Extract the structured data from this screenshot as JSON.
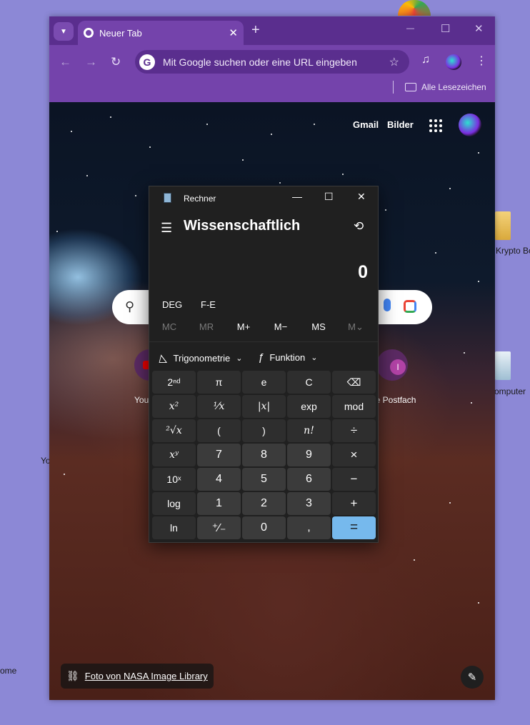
{
  "desktop": {
    "icons": [
      {
        "label": "Krypto Bo"
      },
      {
        "label": "omputer"
      },
      {
        "label": "Yo"
      },
      {
        "label": "ome"
      }
    ]
  },
  "browser": {
    "tab": {
      "title": "Neuer Tab",
      "close": "✕"
    },
    "new_tab": "+",
    "window_controls": {
      "minimize": "—",
      "maximize": "☐",
      "close": "✕"
    },
    "nav": {
      "back": "←",
      "forward": "→",
      "reload": "↻"
    },
    "omnibox": {
      "placeholder": "Mit Google suchen oder eine URL eingeben",
      "badge": "G"
    },
    "bookmarks": {
      "all_label": "Alle Lesezeichen"
    },
    "ntp": {
      "top_links": [
        "Gmail",
        "Bilder"
      ],
      "shortcuts": [
        {
          "label": "You"
        },
        {
          "label": "ne Postfach",
          "letter": "I"
        }
      ],
      "credit": "Foto von NASA Image Library",
      "edit": "✎"
    }
  },
  "calculator": {
    "title": "Rechner",
    "mode": "Wissenschaftlich",
    "display": "0",
    "options": [
      "DEG",
      "F-E"
    ],
    "memory": [
      {
        "label": "MC",
        "enabled": false
      },
      {
        "label": "MR",
        "enabled": false
      },
      {
        "label": "M+",
        "enabled": true
      },
      {
        "label": "M−",
        "enabled": true
      },
      {
        "label": "MS",
        "enabled": true
      },
      {
        "label": "M⌄",
        "enabled": false
      }
    ],
    "dropdowns": [
      {
        "icon": "◺",
        "label": "Trigonometrie"
      },
      {
        "icon": "ƒ",
        "label": "Funktion"
      }
    ],
    "keys": [
      [
        {
          "l": "2ⁿᵈ",
          "t": "fn"
        },
        {
          "l": "π",
          "t": "fn"
        },
        {
          "l": "e",
          "t": "fn"
        },
        {
          "l": "C",
          "t": "fn"
        },
        {
          "l": "⌫",
          "t": "fn"
        }
      ],
      [
        {
          "l": "x²",
          "t": "fn it"
        },
        {
          "l": "¹⁄x",
          "t": "fn it"
        },
        {
          "l": "|x|",
          "t": "fn it"
        },
        {
          "l": "exp",
          "t": "fn"
        },
        {
          "l": "mod",
          "t": "fn"
        }
      ],
      [
        {
          "l": "²√x",
          "t": "fn it"
        },
        {
          "l": "(",
          "t": "fn"
        },
        {
          "l": ")",
          "t": "fn"
        },
        {
          "l": "n!",
          "t": "fn it"
        },
        {
          "l": "÷",
          "t": "op"
        }
      ],
      [
        {
          "l": "xʸ",
          "t": "fn it"
        },
        {
          "l": "7",
          "t": "num"
        },
        {
          "l": "8",
          "t": "num"
        },
        {
          "l": "9",
          "t": "num"
        },
        {
          "l": "×",
          "t": "op"
        }
      ],
      [
        {
          "l": "10ˣ",
          "t": "fn"
        },
        {
          "l": "4",
          "t": "num"
        },
        {
          "l": "5",
          "t": "num"
        },
        {
          "l": "6",
          "t": "num"
        },
        {
          "l": "−",
          "t": "op"
        }
      ],
      [
        {
          "l": "log",
          "t": "fn"
        },
        {
          "l": "1",
          "t": "num"
        },
        {
          "l": "2",
          "t": "num"
        },
        {
          "l": "3",
          "t": "num"
        },
        {
          "l": "+",
          "t": "op"
        }
      ],
      [
        {
          "l": "ln",
          "t": "fn"
        },
        {
          "l": "⁺∕₋",
          "t": "num"
        },
        {
          "l": "0",
          "t": "num"
        },
        {
          "l": ",",
          "t": "num"
        },
        {
          "l": "=",
          "t": "eq"
        }
      ]
    ]
  }
}
